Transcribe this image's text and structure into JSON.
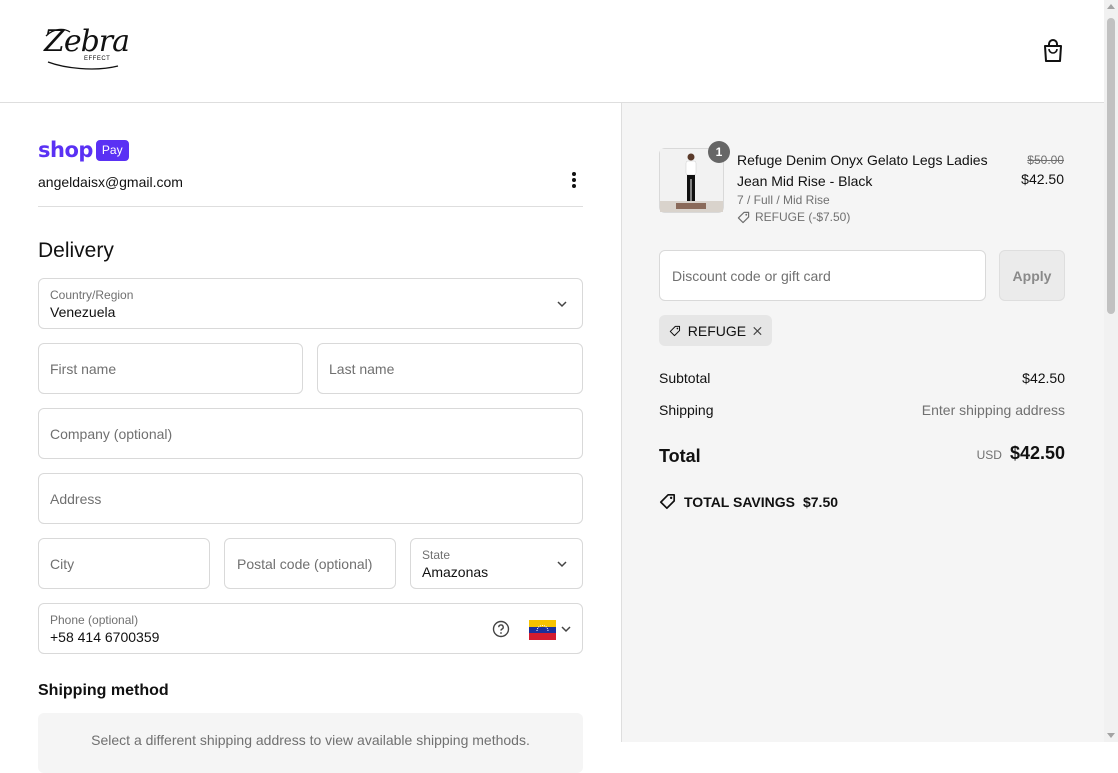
{
  "header": {
    "logo_text": "Zebra",
    "logo_sub": "EFFECT",
    "cart_icon": "shopping-bag-icon"
  },
  "express": {
    "shop_word": "shop",
    "pay_label": "Pay",
    "email": "angeldaisx@gmail.com",
    "menu_icon": "kebab-menu-icon"
  },
  "delivery": {
    "heading": "Delivery",
    "country_label": "Country/Region",
    "country_value": "Venezuela",
    "first_name_placeholder": "First name",
    "last_name_placeholder": "Last name",
    "company_placeholder": "Company (optional)",
    "address_placeholder": "Address",
    "city_placeholder": "City",
    "postal_placeholder": "Postal code (optional)",
    "state_label": "State",
    "state_value": "Amazonas",
    "phone_label": "Phone (optional)",
    "phone_value": "+58 414 6700359",
    "phone_help_icon": "question-circle-icon",
    "phone_flag": "venezuela-flag-icon"
  },
  "shipping": {
    "heading": "Shipping method",
    "message": "Select a different shipping address to view available shipping methods."
  },
  "summary": {
    "product": {
      "quantity": "1",
      "name": "Refuge Denim Onyx Gelato Legs Ladies Jean Mid Rise - Black",
      "variant": "7 / Full / Mid Rise",
      "discount": "REFUGE (-$7.50)",
      "original_price": "$50.00",
      "price": "$42.50"
    },
    "discount_placeholder": "Discount code or gift card",
    "apply_label": "Apply",
    "applied_code": "REFUGE",
    "subtotal_label": "Subtotal",
    "subtotal_value": "$42.50",
    "shipping_label": "Shipping",
    "shipping_value": "Enter shipping address",
    "total_label": "Total",
    "currency": "USD",
    "total_value": "$42.50",
    "savings_label": "TOTAL SAVINGS",
    "savings_value": "$7.50"
  },
  "colors": {
    "shop_pay": "#5a31f4",
    "summary_bg": "#f5f5f5",
    "border": "#d9d9d9",
    "muted_text": "#707070"
  }
}
